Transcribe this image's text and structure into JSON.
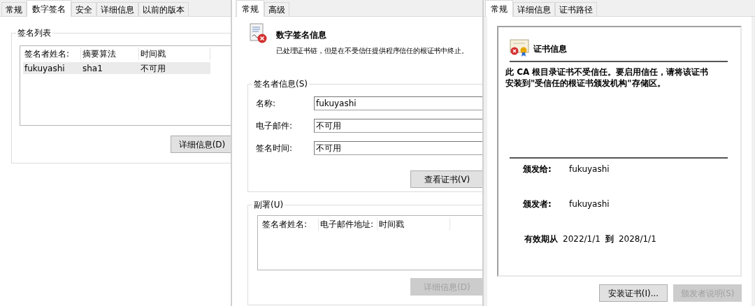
{
  "signatures_panel": {
    "tabs": [
      {
        "label": "常规",
        "selected": false
      },
      {
        "label": "数字签名",
        "selected": true
      },
      {
        "label": "安全",
        "selected": false
      },
      {
        "label": "详细信息",
        "selected": false
      },
      {
        "label": "以前的版本",
        "selected": false
      }
    ],
    "group_title": "签名列表",
    "columns": [
      "签名者姓名:",
      "摘要算法",
      "时间戳"
    ],
    "rows": [
      {
        "cells": [
          "fukuyashi",
          "sha1",
          "不可用"
        ],
        "selected": true
      }
    ],
    "details_button": {
      "label": "详细信息(D)",
      "disabled": false
    }
  },
  "signature_info_panel": {
    "tabs": [
      {
        "label": "常规",
        "selected": true
      },
      {
        "label": "高级",
        "selected": false
      }
    ],
    "title": "数字签名信息",
    "message": "已处理证书链，但是在不受信任提供程序信任的根证书中终止。",
    "signer_group": {
      "title": "签名者信息(S)",
      "fields": [
        {
          "label": "名称:",
          "value": "fukuyashi"
        },
        {
          "label": "电子邮件:",
          "value": "不可用"
        },
        {
          "label": "签名时间:",
          "value": "不可用"
        }
      ],
      "button": {
        "label": "查看证书(V)",
        "disabled": false
      }
    },
    "countersign_group": {
      "title": "副署(U)",
      "columns": [
        "签名者姓名:",
        "电子邮件地址:",
        "时间戳"
      ],
      "button": {
        "label": "详细信息(D)",
        "disabled": true
      }
    }
  },
  "certificate_panel": {
    "tabs": [
      {
        "label": "常规",
        "selected": true
      },
      {
        "label": "详细信息",
        "selected": false
      },
      {
        "label": "证书路径",
        "selected": false
      }
    ],
    "title": "证书信息",
    "message": "此 CA 根目录证书不受信任。要启用信任，请将该证书安装到\"受信任的根证书颁发机构\"存储区。",
    "issued_to_label": "颁发给:",
    "issued_to": "fukuyashi",
    "issued_by_label": "颁发者:",
    "issued_by": "fukuyashi",
    "valid_from_label": "有效期从",
    "valid_from": "2022/1/1",
    "valid_to_label": "到",
    "valid_to": "2028/1/1",
    "buttons": [
      {
        "label": "安装证书(I)...",
        "disabled": false
      },
      {
        "label": "颁发者说明(S)",
        "disabled": true
      }
    ]
  }
}
